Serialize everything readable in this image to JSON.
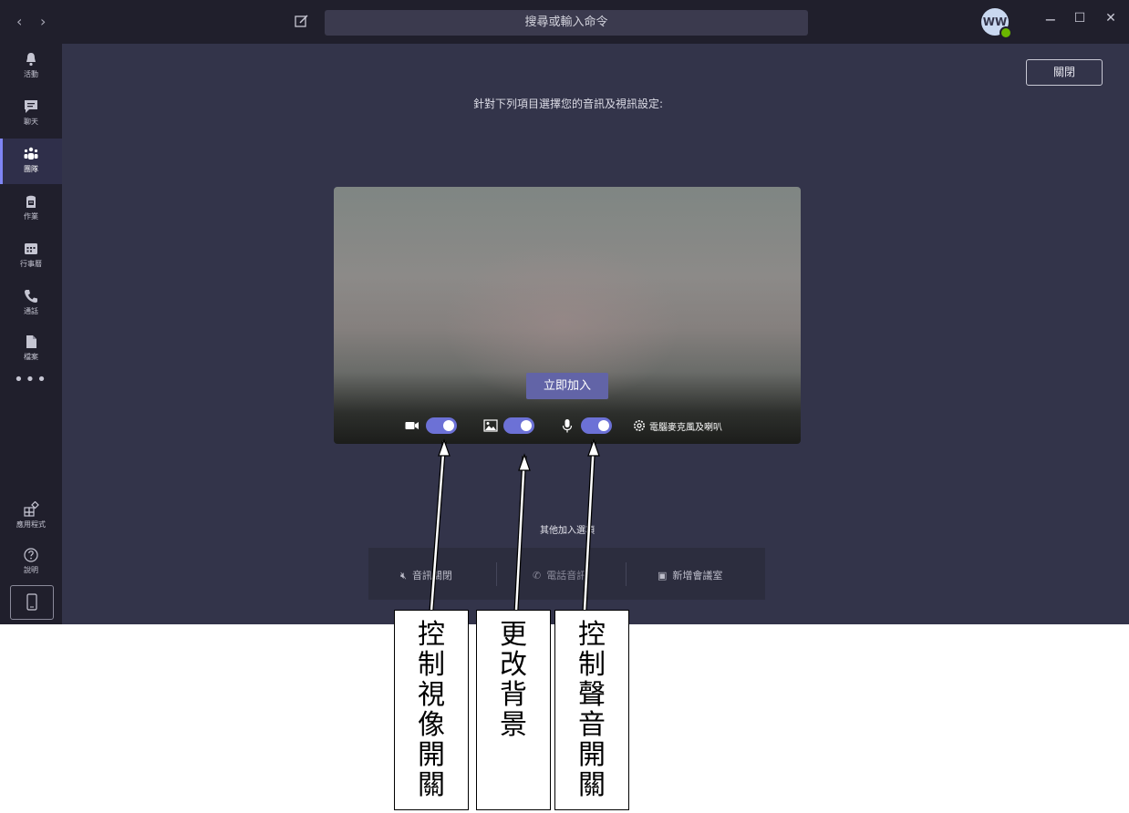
{
  "titlebar": {
    "back_icon": "‹",
    "forward_icon": "›",
    "search_placeholder": "搜尋或輸入命令",
    "avatar_initials": "WW",
    "minimize": "−",
    "maximize": "☐",
    "close": "✕"
  },
  "sidebar": {
    "items": [
      {
        "label": "活動",
        "icon": "bell-icon"
      },
      {
        "label": "聊天",
        "icon": "chat-icon"
      },
      {
        "label": "團隊",
        "icon": "teams-icon"
      },
      {
        "label": "作業",
        "icon": "assignments-icon"
      },
      {
        "label": "行事曆",
        "icon": "calendar-icon"
      },
      {
        "label": "通話",
        "icon": "phone-icon"
      },
      {
        "label": "檔案",
        "icon": "file-icon"
      }
    ],
    "more": "•••",
    "apps_label": "應用程式",
    "help_label": "說明"
  },
  "main": {
    "close_label": "關閉",
    "prompt": "針對下列項目選擇您的音訊及視訊設定:",
    "join_label": "立即加入",
    "audio_device_label": "電腦麥克風及喇叭",
    "video_on": true,
    "background_on": true,
    "mic_on": true,
    "other_options_label": "其他加入選項",
    "other_options": [
      {
        "label": "音訊關閉",
        "icon": "speaker-off-icon"
      },
      {
        "label": "電話音訊",
        "icon": "phone-icon"
      },
      {
        "label": "新增會議室",
        "icon": "room-icon"
      }
    ]
  },
  "annotations": [
    {
      "text": "控制視像開關"
    },
    {
      "text": "更改背景"
    },
    {
      "text": "控制聲音開關"
    }
  ],
  "colors": {
    "app_bg": "#33344a",
    "chrome_bg": "#201f2c",
    "accent": "#6264a7",
    "toggle": "#6c71d6"
  }
}
